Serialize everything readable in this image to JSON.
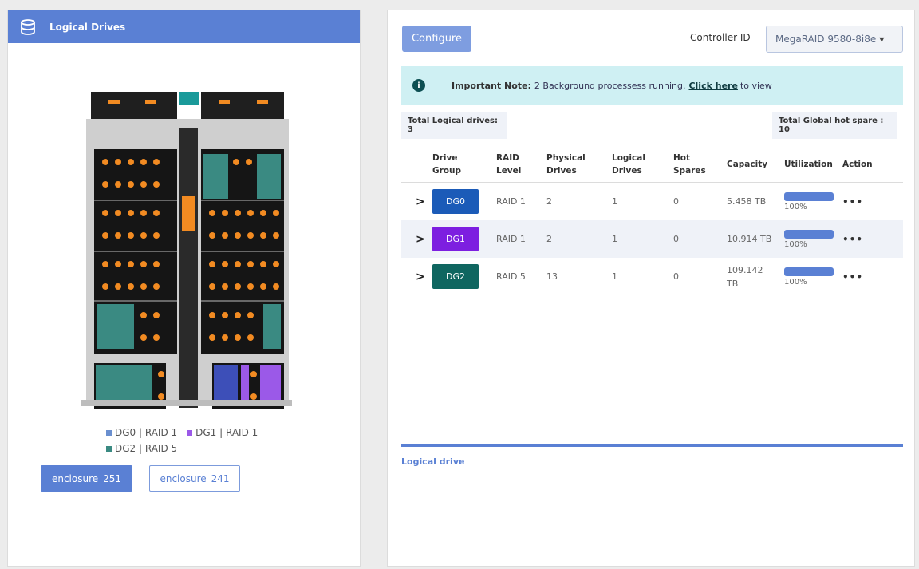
{
  "left_panel": {
    "title": "Logical Drives",
    "legend": [
      {
        "label": "DG0 | RAID 1",
        "color": "#6a8fcf"
      },
      {
        "label": "DG1 | RAID 1",
        "color": "#9b59e8"
      },
      {
        "label": "DG2 | RAID 5",
        "color": "#3a8a82"
      }
    ],
    "enclosures": {
      "primary": "enclosure_251",
      "secondary": "enclosure_241"
    }
  },
  "toolbar": {
    "configure_label": "Configure",
    "controller_label": "Controller ID",
    "controller_value": "MegaRAID 9580-8i8e"
  },
  "note": {
    "icon": "info-icon",
    "heading": "Important Note:",
    "text": "2 Background processess running.",
    "link": "Click here",
    "tail": "to view"
  },
  "stats": {
    "total_logical": "Total Logical drives: 3",
    "total_hot_spare": "Total Global hot spare : 10"
  },
  "table": {
    "headers": {
      "drive_group": "Drive\nGroup",
      "raid_level": "RAID\nLevel",
      "physical": "Physical\nDrives",
      "logical": "Logical\nDrives",
      "hot_spares": "Hot\nSpares",
      "capacity": "Capacity",
      "utilization": "Utilization",
      "action": "Action"
    },
    "rows": [
      {
        "dg": "DG0",
        "dg_color": "#1b5bb8",
        "raid": "RAID 1",
        "physical": "2",
        "logical": "1",
        "hot": "0",
        "capacity": "5.458 TB",
        "util": "100%",
        "util_pct": 100,
        "action": "•••"
      },
      {
        "dg": "DG1",
        "dg_color": "#7d1fe0",
        "raid": "RAID 1",
        "physical": "2",
        "logical": "1",
        "hot": "0",
        "capacity": "10.914 TB",
        "util": "100%",
        "util_pct": 100,
        "action": "•••"
      },
      {
        "dg": "DG2",
        "dg_color": "#0f6660",
        "raid": "RAID 5",
        "physical": "13",
        "logical": "1",
        "hot": "0",
        "capacity": "109.142\nTB",
        "util": "100%",
        "util_pct": 100,
        "action": "•••"
      }
    ]
  },
  "logical_drive_title": "Logical drive",
  "colors": {
    "accent": "#5a80d4",
    "note_bg": "#cff0f3"
  }
}
